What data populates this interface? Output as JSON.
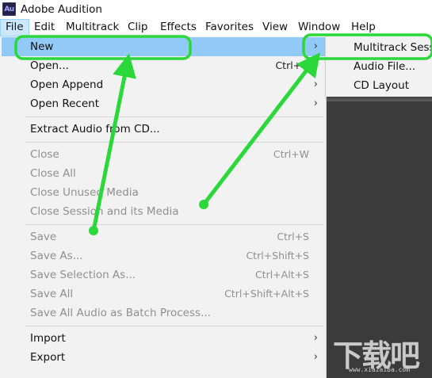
{
  "window": {
    "app_icon_text": "Au",
    "title": "Adobe Audition"
  },
  "menubar": [
    {
      "label": "File",
      "active": true
    },
    {
      "label": "Edit"
    },
    {
      "label": "Multitrack"
    },
    {
      "label": "Clip"
    },
    {
      "label": "Effects"
    },
    {
      "label": "Favorites"
    },
    {
      "label": "View"
    },
    {
      "label": "Window"
    },
    {
      "label": "Help"
    }
  ],
  "file_menu": {
    "new": {
      "label": "New",
      "arrow": "›"
    },
    "open": {
      "label": "Open...",
      "shortcut": "Ctrl+O"
    },
    "open_append": {
      "label": "Open Append",
      "arrow": "›"
    },
    "open_recent": {
      "label": "Open Recent",
      "arrow": "›"
    },
    "extract_audio": {
      "label": "Extract Audio from CD..."
    },
    "close": {
      "label": "Close",
      "shortcut": "Ctrl+W"
    },
    "close_all": {
      "label": "Close All"
    },
    "close_unused": {
      "label": "Close Unused Media"
    },
    "close_session": {
      "label": "Close Session and its Media"
    },
    "save": {
      "label": "Save",
      "shortcut": "Ctrl+S"
    },
    "save_as": {
      "label": "Save As...",
      "shortcut": "Ctrl+Shift+S"
    },
    "save_selection": {
      "label": "Save Selection As...",
      "shortcut": "Ctrl+Alt+S"
    },
    "save_all": {
      "label": "Save All",
      "shortcut": "Ctrl+Shift+Alt+S"
    },
    "save_all_batch": {
      "label": "Save All Audio as Batch Process..."
    },
    "import": {
      "label": "Import",
      "arrow": "›"
    },
    "export": {
      "label": "Export",
      "arrow": "›"
    }
  },
  "new_submenu": {
    "multitrack": {
      "label": "Multitrack Session..."
    },
    "audio_file": {
      "label": "Audio File..."
    },
    "cd_layout": {
      "label": "CD Layout"
    }
  },
  "watermark": {
    "text": "下载吧",
    "sub": "www.xiazaiba.com"
  },
  "colors": {
    "menu_highlight": "#91c9f7",
    "active_menubar": "#cce8ff",
    "annotation_green": "#2bd83a",
    "workspace_dark": "#3b3b3b"
  }
}
